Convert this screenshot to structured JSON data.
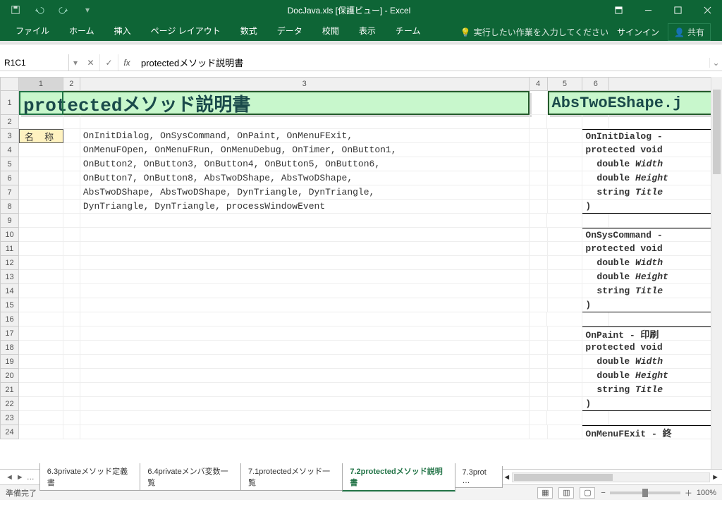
{
  "title": "DocJava.xls  [保護ビュー] - Excel",
  "qat": {
    "save": "保存",
    "undo": "元に戻す",
    "redo": "やり直し"
  },
  "ribbon": {
    "tabs": [
      "ファイル",
      "ホーム",
      "挿入",
      "ページ レイアウト",
      "数式",
      "データ",
      "校閲",
      "表示",
      "チーム"
    ],
    "tellme": "実行したい作業を入力してください",
    "signin": "サインイン",
    "share": "共有"
  },
  "namebox": "R1C1",
  "formula": "protectedメソッド説明書",
  "cols": [
    "1",
    "2",
    "3",
    "4",
    "5",
    "6",
    ""
  ],
  "rows": [
    "1",
    "2",
    "3",
    "4",
    "5",
    "6",
    "7",
    "8",
    "9",
    "10",
    "11",
    "12",
    "13",
    "14",
    "15",
    "16",
    "17",
    "18",
    "19",
    "20",
    "21",
    "22",
    "23",
    "24"
  ],
  "cells": {
    "title1": "protectedメソッド説明書",
    "title2": "AbsTwoEShape.j",
    "label_name": "名 称",
    "l3": "OnInitDialog, OnSysCommand, OnPaint, OnMenuFExit,",
    "l4": "OnMenuFOpen, OnMenuFRun, OnMenuDebug, OnTimer, OnButton1,",
    "l5": "OnButton2, OnButton3, OnButton4, OnButton5, OnButton6,",
    "l6": "OnButton7, OnButton8, AbsTwoDShape, AbsTwoDShape,",
    "l7": "AbsTwoDShape, AbsTwoDShape, DynTriangle, DynTriangle,",
    "l8": "DynTriangle, DynTriangle, processWindowEvent",
    "r": {
      "b1h": "OnInitDialog - ",
      "b2h": "OnSysCommand - ",
      "b3h": "OnPaint  - 印刷",
      "b4h": "OnMenuFExit - 終",
      "sig": "protected void ",
      "w": "double",
      "wi": "Width",
      "h": "double",
      "hi": "Height",
      "s": "string",
      "si": "Title",
      "close": ")"
    }
  },
  "sheets": {
    "tabs": [
      "6.3privateメソッド定義書",
      "6.4privateメンバ変数一覧",
      "7.1protectedメソッド一覧",
      "7.2protectedメソッド説明書",
      "7.3prot …"
    ],
    "active": 3,
    "more": "…"
  },
  "status": {
    "ready": "準備完了",
    "zoom": "100%"
  }
}
